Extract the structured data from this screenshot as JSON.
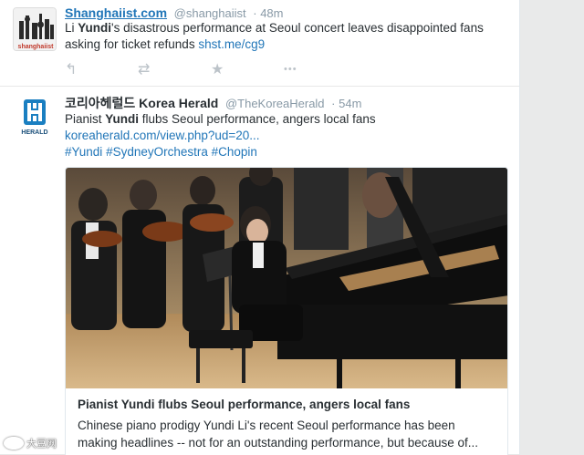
{
  "tweet1": {
    "fullname": "Shanghaiist.com",
    "screenname": "@shanghaiist",
    "time": "48m",
    "text_pre": "Li ",
    "text_bold": "Yundi",
    "text_post": "'s disastrous performance at Seoul concert leaves disappointed fans asking for ticket refunds ",
    "link": "shst.me/cg9",
    "avatar_text": "shanghaiist",
    "actions": [
      "reply-icon",
      "retweet-icon",
      "favorite-icon",
      "more-icon"
    ],
    "action_glyphs": [
      "↰",
      "⇄",
      "★",
      "•••"
    ]
  },
  "tweet2": {
    "fullname": "코리아헤럴드 Korea Herald",
    "screenname": "@TheKoreaHerald",
    "time": "54m",
    "text_pre": "Pianist ",
    "text_bold": "Yundi",
    "text_post": " flubs Seoul performance, angers local fans",
    "link": "koreaherald.com/view.php?ud=20...",
    "hashtags": [
      "#Yundi",
      "#SydneyOrchestra",
      "#Chopin"
    ],
    "avatar_text": "HERALD",
    "card": {
      "title": "Pianist Yundi flubs Seoul performance, angers local fans",
      "description": "Chinese piano prodigy Yundi Li's recent Seoul performance has been making headlines -- not for an outstanding performance, but because of..."
    }
  },
  "watermark": "大豆网",
  "colors": {
    "link": "#2176b8",
    "muted": "#8899a6",
    "text": "#292f33",
    "page_bg": "#e9eaea"
  }
}
